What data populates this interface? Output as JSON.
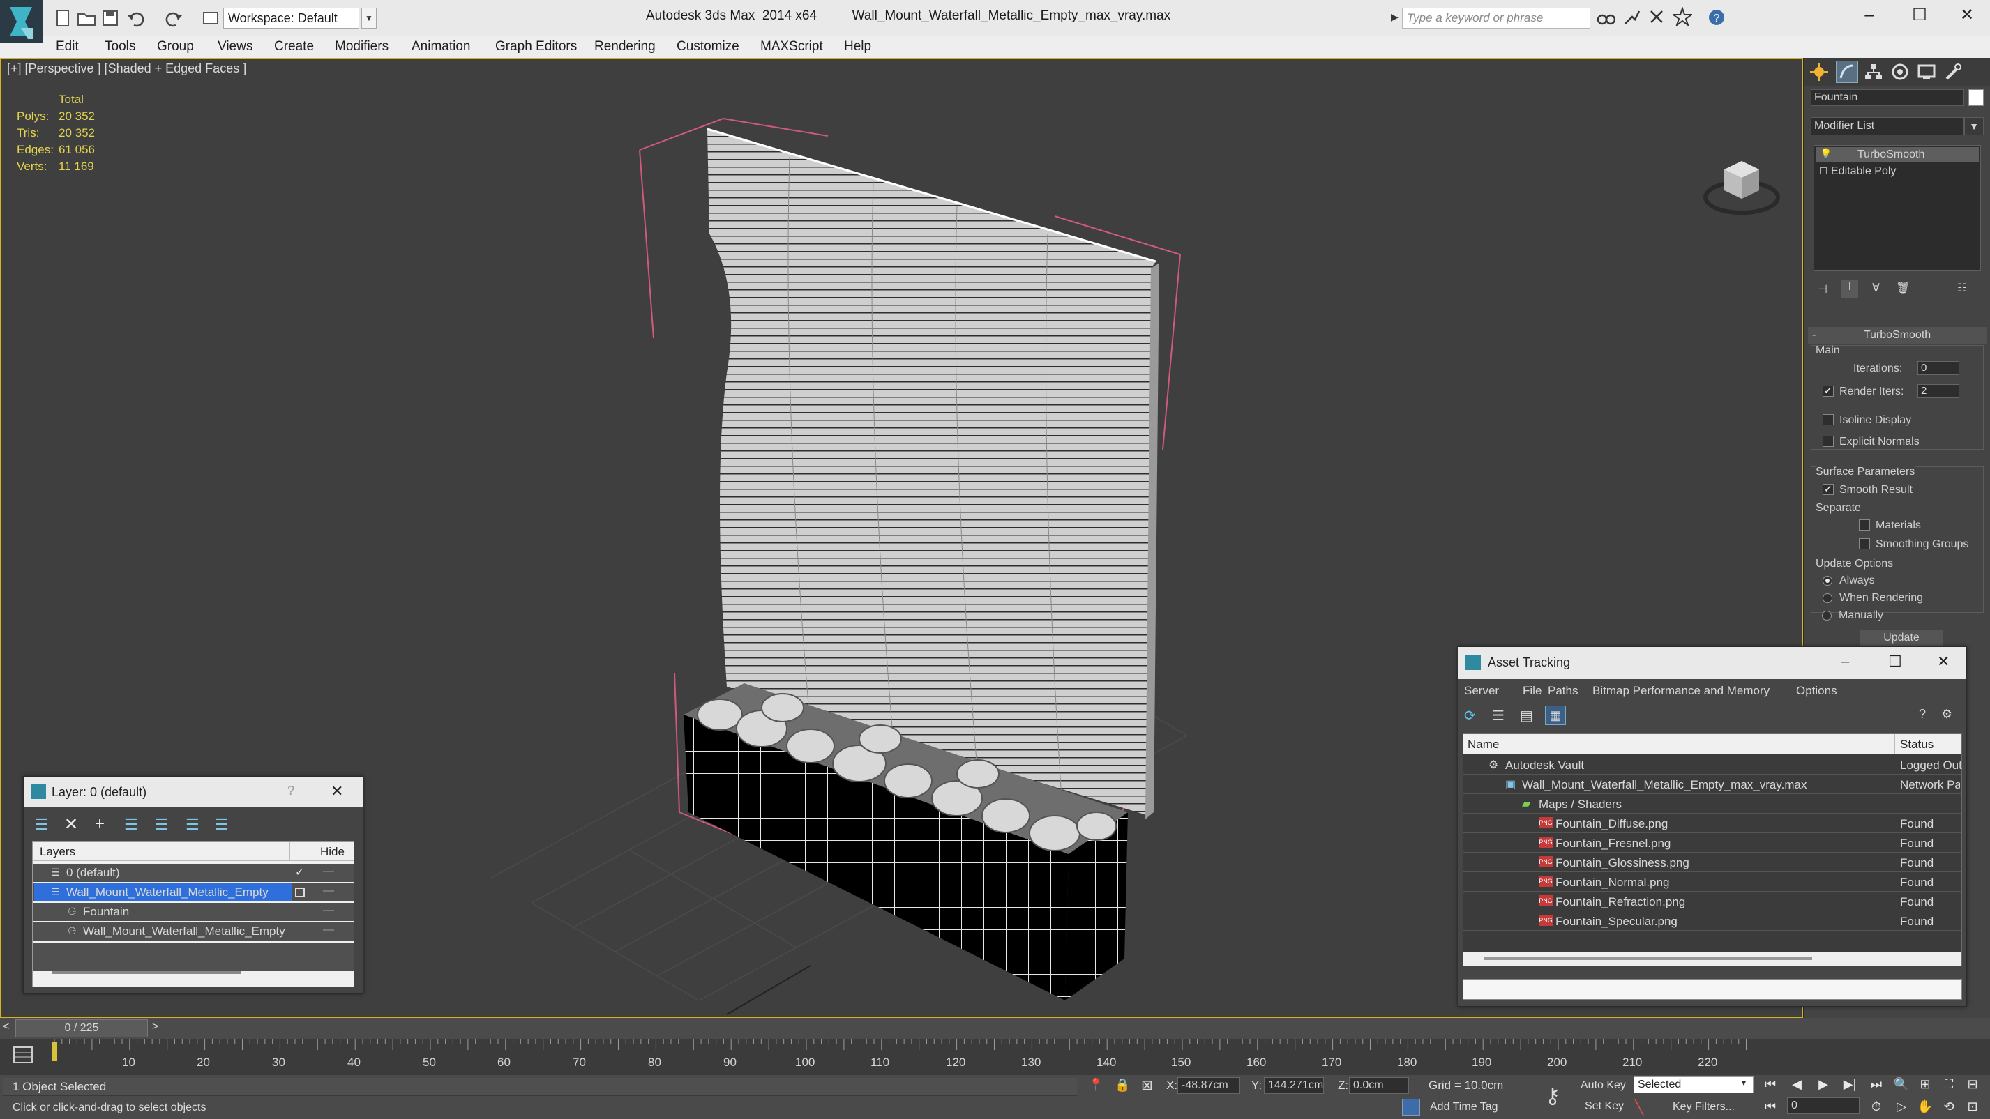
{
  "titlebar": {
    "workspace_label": "Workspace: Default",
    "app_name": "Autodesk 3ds Max  2014 x64",
    "file_name": "Wall_Mount_Waterfall_Metallic_Empty_max_vray.max",
    "search_placeholder": "Type a keyword or phrase"
  },
  "menu": [
    "Edit",
    "Tools",
    "Group",
    "Views",
    "Create",
    "Modifiers",
    "Animation",
    "Graph Editors",
    "Rendering",
    "Customize",
    "MAXScript",
    "Help"
  ],
  "viewport": {
    "label": "[+] [Perspective ] [Shaded + Edged Faces ]",
    "stats": {
      "header": "Total",
      "polys_label": "Polys:",
      "polys": "20 352",
      "tris_label": "Tris:",
      "tris": "20 352",
      "edges_label": "Edges:",
      "edges": "61 056",
      "verts_label": "Verts:",
      "verts": "11 169"
    }
  },
  "command_panel": {
    "object_name": "Fountain",
    "modifier_list": "Modifier List",
    "stack": [
      "TurboSmooth",
      "Editable Poly"
    ],
    "rollout_title": "TurboSmooth",
    "main_group": "Main",
    "iterations_label": "Iterations:",
    "iterations_value": "0",
    "render_iters_label": "Render Iters:",
    "render_iters_value": "2",
    "isoline_label": "Isoline Display",
    "explicit_normals_label": "Explicit Normals",
    "surface_group": "Surface Parameters",
    "smooth_result_label": "Smooth Result",
    "separate_group": "Separate",
    "materials_label": "Materials",
    "smoothing_groups_label": "Smoothing Groups",
    "update_group": "Update Options",
    "always_label": "Always",
    "when_rendering_label": "When Rendering",
    "manually_label": "Manually",
    "update_button": "Update"
  },
  "layer_window": {
    "title": "Layer: 0 (default)",
    "help": "?",
    "col_layers": "Layers",
    "col_hide": "Hide",
    "rows": [
      "0 (default)",
      "Wall_Mount_Waterfall_Metallic_Empty",
      "Fountain",
      "Wall_Mount_Waterfall_Metallic_Empty"
    ]
  },
  "asset_window": {
    "title": "Asset Tracking",
    "menu": [
      "Server",
      "File",
      "Paths",
      "Bitmap Performance and Memory",
      "Options"
    ],
    "col_name": "Name",
    "col_status": "Status",
    "rows": [
      {
        "name": "Autodesk Vault",
        "status": "Logged Out"
      },
      {
        "name": "Wall_Mount_Waterfall_Metallic_Empty_max_vray.max",
        "status": "Network Pa"
      },
      {
        "name": "Maps / Shaders",
        "status": ""
      },
      {
        "name": "Fountain_Diffuse.png",
        "status": "Found"
      },
      {
        "name": "Fountain_Fresnel.png",
        "status": "Found"
      },
      {
        "name": "Fountain_Glossiness.png",
        "status": "Found"
      },
      {
        "name": "Fountain_Normal.png",
        "status": "Found"
      },
      {
        "name": "Fountain_Refraction.png",
        "status": "Found"
      },
      {
        "name": "Fountain_Specular.png",
        "status": "Found"
      }
    ]
  },
  "timeline": {
    "frame_counter": "0 / 225",
    "ticks": [
      "10",
      "20",
      "30",
      "40",
      "50",
      "60",
      "70",
      "80",
      "90",
      "100",
      "110",
      "120",
      "130",
      "140",
      "150",
      "160",
      "170",
      "180",
      "190",
      "200",
      "210",
      "220"
    ]
  },
  "status": {
    "selected_text": "1 Object Selected",
    "prompt": "Click or click-and-drag to select objects",
    "x_label": "X:",
    "x_value": "-48.87cm",
    "y_label": "Y:",
    "y_value": "144.271cm",
    "z_label": "Z:",
    "z_value": "0.0cm",
    "grid": "Grid = 10.0cm",
    "add_time_tag": "Add Time Tag",
    "auto_key": "Auto Key",
    "set_key": "Set Key",
    "selected_dropdown": "Selected",
    "key_filters": "Key Filters...",
    "frame_value": "0"
  }
}
